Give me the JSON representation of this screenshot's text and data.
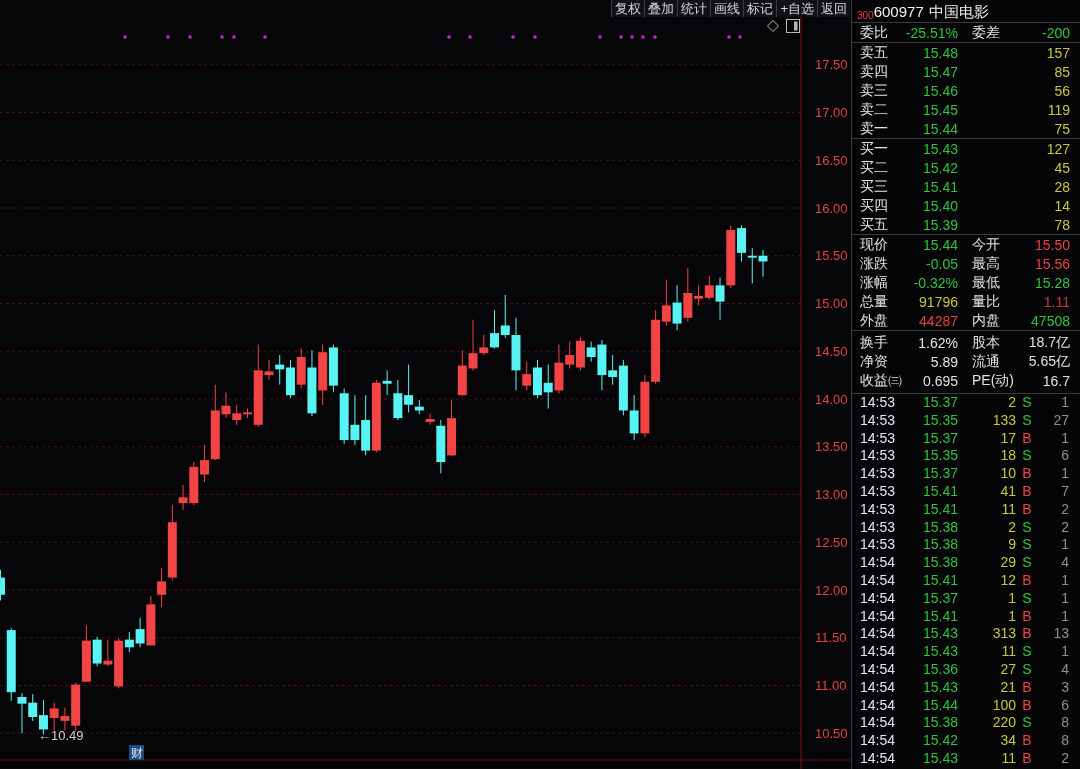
{
  "toolbar": {
    "buttons": [
      "复权",
      "叠加",
      "统计",
      "画线",
      "标记",
      "+自选",
      "返回"
    ]
  },
  "chart": {
    "chart_data": {
      "type": "candlestick",
      "categories": [
        null,
        null,
        null,
        null,
        null,
        null,
        null,
        null,
        null,
        null,
        null,
        null,
        null,
        null,
        null,
        null,
        null,
        null,
        null,
        null,
        null,
        null,
        null,
        null,
        null,
        null,
        null,
        null,
        null,
        null,
        null,
        null,
        null,
        null,
        null,
        null,
        null,
        null,
        null,
        null,
        null,
        null,
        null,
        null,
        null,
        null,
        null,
        null,
        null,
        null,
        null,
        null,
        null,
        null,
        null,
        null,
        null,
        null,
        null,
        null,
        null,
        null,
        null,
        null,
        null,
        null,
        null,
        null,
        null,
        null,
        null,
        null
      ],
      "ohlc": [
        [
          12.13,
          12.21,
          11.89,
          11.95
        ],
        [
          11.58,
          11.6,
          10.84,
          10.93
        ],
        [
          10.88,
          10.92,
          10.5,
          10.81
        ],
        [
          10.82,
          10.91,
          10.63,
          10.67
        ],
        [
          10.69,
          10.85,
          10.49,
          10.54
        ],
        [
          10.66,
          10.82,
          10.53,
          10.76
        ],
        [
          10.63,
          10.77,
          10.53,
          10.68
        ],
        [
          10.58,
          11.03,
          10.52,
          11.01
        ],
        [
          11.04,
          11.63,
          11.04,
          11.47
        ],
        [
          11.48,
          11.51,
          11.2,
          11.23
        ],
        [
          11.22,
          11.48,
          11.2,
          11.26
        ],
        [
          10.99,
          11.5,
          10.97,
          11.47
        ],
        [
          11.48,
          11.56,
          11.35,
          11.4
        ],
        [
          11.59,
          11.71,
          11.4,
          11.44
        ],
        [
          11.42,
          11.94,
          11.42,
          11.85
        ],
        [
          11.95,
          12.23,
          11.82,
          12.09
        ],
        [
          12.13,
          12.89,
          12.1,
          12.71
        ],
        [
          12.91,
          13.1,
          12.84,
          12.97
        ],
        [
          12.91,
          13.34,
          12.89,
          13.29
        ],
        [
          13.21,
          13.52,
          13.13,
          13.36
        ],
        [
          13.37,
          14.15,
          13.36,
          13.88
        ],
        [
          13.84,
          14.07,
          13.8,
          13.93
        ],
        [
          13.78,
          13.94,
          13.73,
          13.85
        ],
        [
          13.84,
          13.9,
          13.8,
          13.86
        ],
        [
          13.73,
          14.57,
          13.71,
          14.3
        ],
        [
          14.25,
          14.41,
          14.2,
          14.29
        ],
        [
          14.36,
          14.46,
          14.15,
          14.31
        ],
        [
          14.33,
          14.41,
          14.01,
          14.04
        ],
        [
          14.15,
          14.53,
          14.11,
          14.44
        ],
        [
          14.33,
          14.51,
          13.82,
          13.85
        ],
        [
          14.09,
          14.57,
          13.94,
          14.49
        ],
        [
          14.54,
          14.57,
          14.07,
          14.14
        ],
        [
          14.06,
          14.11,
          13.53,
          13.57
        ],
        [
          13.73,
          14.04,
          13.52,
          13.57
        ],
        [
          13.78,
          14.04,
          13.41,
          13.46
        ],
        [
          13.46,
          14.2,
          13.44,
          14.17
        ],
        [
          14.19,
          14.3,
          14.04,
          14.16
        ],
        [
          14.06,
          14.2,
          13.78,
          13.8
        ],
        [
          14.04,
          14.36,
          13.86,
          13.94
        ],
        [
          13.92,
          13.99,
          13.84,
          13.88
        ],
        [
          13.76,
          13.85,
          13.73,
          13.79
        ],
        [
          13.72,
          13.78,
          13.22,
          13.34
        ],
        [
          13.41,
          13.99,
          13.4,
          13.8
        ],
        [
          14.04,
          14.51,
          14.03,
          14.35
        ],
        [
          14.32,
          14.83,
          14.3,
          14.48
        ],
        [
          14.48,
          14.67,
          14.46,
          14.54
        ],
        [
          14.69,
          14.93,
          14.53,
          14.54
        ],
        [
          14.77,
          15.09,
          14.64,
          14.67
        ],
        [
          14.67,
          14.85,
          14.09,
          14.3
        ],
        [
          14.14,
          14.39,
          14.09,
          14.26
        ],
        [
          14.33,
          14.41,
          14.01,
          14.04
        ],
        [
          14.17,
          14.36,
          13.9,
          14.07
        ],
        [
          14.09,
          14.57,
          14.06,
          14.38
        ],
        [
          14.36,
          14.6,
          14.32,
          14.46
        ],
        [
          14.33,
          14.65,
          14.3,
          14.61
        ],
        [
          14.54,
          14.6,
          14.39,
          14.44
        ],
        [
          14.57,
          14.62,
          14.09,
          14.25
        ],
        [
          14.3,
          14.46,
          14.15,
          14.23
        ],
        [
          14.35,
          14.41,
          13.83,
          13.88
        ],
        [
          13.88,
          14.04,
          13.57,
          13.64
        ],
        [
          13.64,
          14.25,
          13.6,
          14.18
        ],
        [
          14.18,
          14.93,
          14.16,
          14.83
        ],
        [
          14.81,
          15.25,
          14.77,
          14.98
        ],
        [
          15.01,
          15.19,
          14.72,
          14.79
        ],
        [
          14.85,
          15.37,
          14.81,
          15.11
        ],
        [
          15.05,
          15.19,
          14.98,
          15.08
        ],
        [
          15.06,
          15.29,
          15.04,
          15.19
        ],
        [
          15.19,
          15.27,
          14.83,
          15.02
        ],
        [
          15.19,
          15.82,
          15.16,
          15.77
        ],
        [
          15.79,
          15.82,
          15.44,
          15.53
        ],
        [
          15.5,
          15.58,
          15.21,
          15.48
        ],
        [
          15.5,
          15.56,
          15.28,
          15.44
        ]
      ],
      "ylim": [
        10.22,
        18.0
      ],
      "grid": true,
      "yticks": [
        {
          "value": 17.5,
          "label": "17.50"
        },
        {
          "value": 17.0,
          "label": "17.00"
        },
        {
          "value": 16.5,
          "label": "16.50"
        },
        {
          "value": 16.0,
          "label": "16.00"
        },
        {
          "value": 15.5,
          "label": "15.50"
        },
        {
          "value": 15.0,
          "label": "15.00"
        },
        {
          "value": 14.5,
          "label": "14.50"
        },
        {
          "value": 14.0,
          "label": "14.00"
        },
        {
          "value": 13.5,
          "label": "13.50"
        },
        {
          "value": 13.0,
          "label": "13.00"
        },
        {
          "value": 12.5,
          "label": "12.50"
        },
        {
          "value": 12.0,
          "label": "12.00"
        },
        {
          "value": 11.5,
          "label": "11.50"
        },
        {
          "value": 11.0,
          "label": "11.00"
        },
        {
          "value": 10.5,
          "label": "10.50"
        }
      ]
    },
    "low_label": "←10.49",
    "event_tag": "财"
  },
  "quote": {
    "index_tag": "300",
    "code": "600977",
    "name": "中国电影"
  },
  "order_imbalance": [
    {
      "label": "委比",
      "value": "-25.51%"
    },
    {
      "label": "委差",
      "value": "-200"
    }
  ],
  "asks": [
    {
      "label": "卖五",
      "price": "15.48",
      "volume": "157"
    },
    {
      "label": "卖四",
      "price": "15.47",
      "volume": "85"
    },
    {
      "label": "卖三",
      "price": "15.46",
      "volume": "56"
    },
    {
      "label": "卖二",
      "price": "15.45",
      "volume": "119"
    },
    {
      "label": "卖一",
      "price": "15.44",
      "volume": "75"
    }
  ],
  "bids": [
    {
      "label": "买一",
      "price": "15.43",
      "volume": "127"
    },
    {
      "label": "买二",
      "price": "15.42",
      "volume": "45"
    },
    {
      "label": "买三",
      "price": "15.41",
      "volume": "28"
    },
    {
      "label": "买四",
      "price": "15.40",
      "volume": "14"
    },
    {
      "label": "买五",
      "price": "15.39",
      "volume": "78"
    }
  ],
  "stats": [
    {
      "label": "现价",
      "value": "15.44",
      "color": "#30c43c"
    },
    {
      "label": "今开",
      "value": "15.50",
      "color": "#e84444"
    },
    {
      "label": "涨跌",
      "value": "-0.05",
      "color": "#30c43c"
    },
    {
      "label": "最高",
      "value": "15.56",
      "color": "#e84444"
    },
    {
      "label": "涨幅",
      "value": "-0.32%",
      "color": "#30c43c"
    },
    {
      "label": "最低",
      "value": "15.28",
      "color": "#30c43c"
    },
    {
      "label": "总量",
      "value": "91796",
      "color": "#c8c83c"
    },
    {
      "label": "量比",
      "value": "1.11",
      "color": "#c83838"
    },
    {
      "label": "外盘",
      "value": "44287",
      "color": "#e84444"
    },
    {
      "label": "内盘",
      "value": "47508",
      "color": "#30c43c"
    }
  ],
  "fundamentals": [
    {
      "label": "换手",
      "value": "1.62%"
    },
    {
      "label": "股本",
      "value": "18.7亿"
    },
    {
      "label": "净资",
      "value": "5.89"
    },
    {
      "label": "流通",
      "value": "5.65亿"
    },
    {
      "label": "收益㈢",
      "value": "0.695"
    },
    {
      "label": "PE(动)",
      "value": "16.7"
    }
  ],
  "trades": [
    {
      "time": "14:53",
      "price": "15.37",
      "volume": "2",
      "side": "S",
      "count": "1",
      "kind": "sell"
    },
    {
      "time": "14:53",
      "price": "15.35",
      "volume": "133",
      "side": "S",
      "count": "27",
      "kind": "sell"
    },
    {
      "time": "14:53",
      "price": "15.37",
      "volume": "17",
      "side": "B",
      "count": "1",
      "kind": "buy"
    },
    {
      "time": "14:53",
      "price": "15.35",
      "volume": "18",
      "side": "S",
      "count": "6",
      "kind": "sell"
    },
    {
      "time": "14:53",
      "price": "15.37",
      "volume": "10",
      "side": "B",
      "count": "1",
      "kind": "buy"
    },
    {
      "time": "14:53",
      "price": "15.41",
      "volume": "41",
      "side": "B",
      "count": "7",
      "kind": "buy"
    },
    {
      "time": "14:53",
      "price": "15.41",
      "volume": "11",
      "side": "B",
      "count": "2",
      "kind": "buy"
    },
    {
      "time": "14:53",
      "price": "15.38",
      "volume": "2",
      "side": "S",
      "count": "2",
      "kind": "sell"
    },
    {
      "time": "14:53",
      "price": "15.38",
      "volume": "9",
      "side": "S",
      "count": "1",
      "kind": "sell"
    },
    {
      "time": "14:54",
      "price": "15.38",
      "volume": "29",
      "side": "S",
      "count": "4",
      "kind": "sell"
    },
    {
      "time": "14:54",
      "price": "15.41",
      "volume": "12",
      "side": "B",
      "count": "1",
      "kind": "buy"
    },
    {
      "time": "14:54",
      "price": "15.37",
      "volume": "1",
      "side": "S",
      "count": "1",
      "kind": "sell"
    },
    {
      "time": "14:54",
      "price": "15.41",
      "volume": "1",
      "side": "B",
      "count": "1",
      "kind": "buy"
    },
    {
      "time": "14:54",
      "price": "15.43",
      "volume": "313",
      "side": "B",
      "count": "13",
      "kind": "buy"
    },
    {
      "time": "14:54",
      "price": "15.43",
      "volume": "11",
      "side": "S",
      "count": "1",
      "kind": "sell"
    },
    {
      "time": "14:54",
      "price": "15.36",
      "volume": "27",
      "side": "S",
      "count": "4",
      "kind": "sell"
    },
    {
      "time": "14:54",
      "price": "15.43",
      "volume": "21",
      "side": "B",
      "count": "3",
      "kind": "buy"
    },
    {
      "time": "14:54",
      "price": "15.44",
      "volume": "100",
      "side": "B",
      "count": "6",
      "kind": "buy"
    },
    {
      "time": "14:54",
      "price": "15.38",
      "volume": "220",
      "side": "S",
      "count": "8",
      "kind": "sell"
    },
    {
      "time": "14:54",
      "price": "15.42",
      "volume": "34",
      "side": "B",
      "count": "8",
      "kind": "buy"
    },
    {
      "time": "14:54",
      "price": "15.43",
      "volume": "11",
      "side": "B",
      "count": "2",
      "kind": "buy"
    }
  ]
}
